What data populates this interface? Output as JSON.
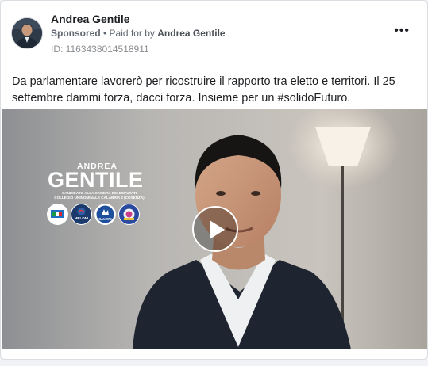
{
  "post": {
    "author": "Andrea Gentile",
    "sponsored_label": "Sponsored",
    "paid_for_prefix": " • Paid for by ",
    "paid_for_by": "Andrea Gentile",
    "ad_id": "ID: 1163438014518911",
    "body": "Da parlamentare lavorerò per ricostruire il rapporto tra eletto e territori. Il 25 settembre dammi forza, dacci forza. Insieme per un #solidoFuturo.",
    "more_label": "•••"
  },
  "video": {
    "candidate_first": "ANDREA",
    "candidate_last": "GENTILE",
    "candidate_role_1": "CANDIDATO ALLA CAMERA DEI DEPUTATI",
    "candidate_role_2": "COLLEGIO UNINOMINALE CALABRIA 2 (COSENZA)",
    "party_logos": [
      "forza-italia-logo",
      "fratelli-d-italia-logo",
      "lega-salvini-logo",
      "noi-moderati-logo"
    ],
    "logo_text_meloni": "MELONI",
    "logo_text_salvini": "SALVINI",
    "play_icon": "play-icon"
  },
  "colors": {
    "text_primary": "#1c1e21",
    "text_secondary": "#606770",
    "card_border": "#dadde1",
    "forza_italia": "#1f6fc2",
    "fdi": "#1b3a6b",
    "lega": "#1d4f9c",
    "noi_moderati": "#2a4aa0"
  }
}
